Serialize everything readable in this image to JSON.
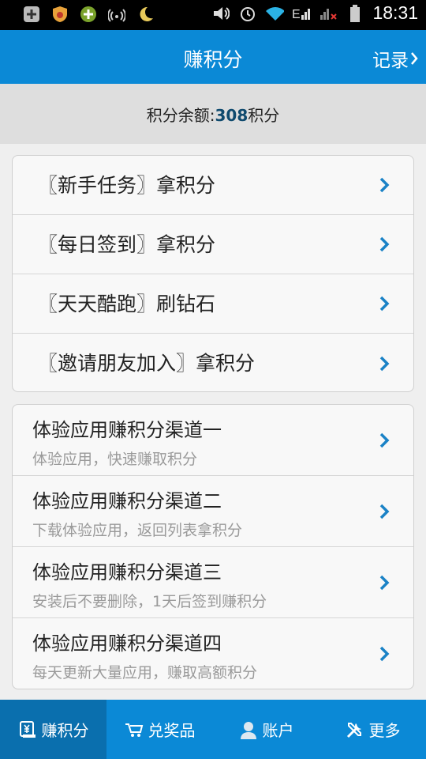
{
  "status": {
    "time": "18:31"
  },
  "header": {
    "title": "赚积分",
    "record_label": "记录"
  },
  "balance": {
    "prefix": "积分余额:",
    "amount": "308",
    "suffix": "积分"
  },
  "tasks": [
    {
      "label": "〖新手任务〗拿积分"
    },
    {
      "label": "〖每日签到〗拿积分"
    },
    {
      "label": "〖天天酷跑〗刷钻石"
    },
    {
      "label": "〖邀请朋友加入〗拿积分"
    }
  ],
  "channels": [
    {
      "title": "体验应用赚积分渠道一",
      "subtitle": "体验应用，快速赚取积分"
    },
    {
      "title": "体验应用赚积分渠道二",
      "subtitle": "下载体验应用，返回列表拿积分"
    },
    {
      "title": "体验应用赚积分渠道三",
      "subtitle": "安装后不要删除，1天后签到赚积分"
    },
    {
      "title": "体验应用赚积分渠道四",
      "subtitle": "每天更新大量应用，赚取高额积分"
    }
  ],
  "nav": [
    {
      "label": "赚积分",
      "icon": "yen-card-icon",
      "active": true
    },
    {
      "label": "兑奖品",
      "icon": "cart-icon"
    },
    {
      "label": "账户",
      "icon": "user-icon"
    },
    {
      "label": "更多",
      "icon": "tools-icon"
    }
  ],
  "colors": {
    "primary": "#0b89d6",
    "primary_dark": "#0a6fae",
    "chevron": "#1a82c6"
  }
}
